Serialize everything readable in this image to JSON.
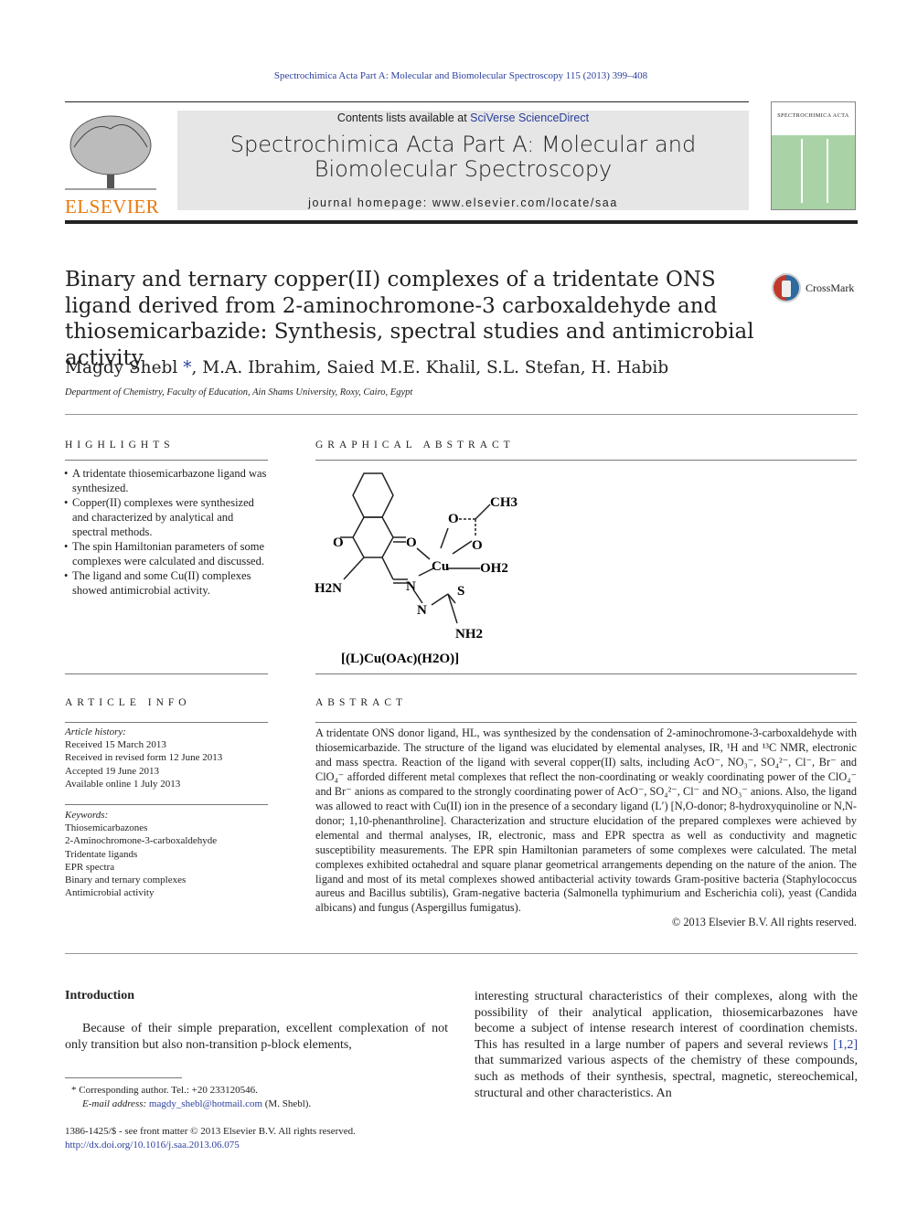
{
  "header": {
    "citation": "Spectrochimica Acta Part A: Molecular and Biomolecular Spectroscopy 115 (2013) 399–408",
    "contents_prefix": "Contents lists available at ",
    "contents_link": "SciVerse ScienceDirect",
    "journal_title_line1": "Spectrochimica Acta Part A: Molecular and",
    "journal_title_line2": "Biomolecular Spectroscopy",
    "homepage": "journal homepage: www.elsevier.com/locate/saa",
    "publisher_logo": "ELSEVIER",
    "cover_text": "SPECTROCHIMICA ACTA",
    "crossmark": "CrossMark"
  },
  "article": {
    "title": "Binary and ternary copper(II) complexes of a tridentate ONS ligand derived from 2-aminochromone-3 carboxaldehyde and thiosemicarbazide: Synthesis, spectral studies and antimicrobial activity",
    "authors_first": "Magdy Shebl",
    "author_mark": "*",
    "authors_rest": ", M.A. Ibrahim, Saied M.E. Khalil, S.L. Stefan, H. Habib",
    "affiliation": "Department of Chemistry, Faculty of Education, Ain Shams University, Roxy, Cairo, Egypt"
  },
  "highlights": {
    "heading": "HIGHLIGHTS",
    "items": [
      "A tridentate thiosemicarbazone ligand was synthesized.",
      "Copper(II) complexes were synthesized and characterized by analytical and spectral methods.",
      "The spin Hamiltonian parameters of some complexes were calculated and discussed.",
      "The ligand and some Cu(II) complexes showed antimicrobial activity."
    ]
  },
  "graphical_abstract": {
    "heading": "GRAPHICAL ABSTRACT",
    "labels": {
      "o_ring": "O",
      "o_carbonyl": "O",
      "h2n": "H2N",
      "n_imine": "N",
      "n_hydrazine": "N",
      "s": "S",
      "nh2": "NH2",
      "cu": "Cu",
      "oh2": "OH2",
      "o_acetate1": "O",
      "o_acetate2": "O",
      "ch3": "CH3"
    },
    "caption": "[(L)Cu(OAc)(H2O)]"
  },
  "article_info": {
    "heading": "ARTICLE INFO",
    "history_label": "Article history:",
    "history": [
      "Received 15 March 2013",
      "Received in revised form 12 June 2013",
      "Accepted 19 June 2013",
      "Available online 1 July 2013"
    ],
    "keywords_label": "Keywords:",
    "keywords": [
      "Thiosemicarbazones",
      "2-Aminochromone-3-carboxaldehyde",
      "Tridentate ligands",
      "EPR spectra",
      "Binary and ternary complexes",
      "Antimicrobial activity"
    ]
  },
  "abstract": {
    "heading": "ABSTRACT",
    "text": "A tridentate ONS donor ligand, HL, was synthesized by the condensation of 2-aminochromone-3-carboxaldehyde with thiosemicarbazide. The structure of the ligand was elucidated by elemental analyses, IR, ¹H and ¹³C NMR, electronic and mass spectra. Reaction of the ligand with several copper(II) salts, including AcO⁻, NO₃⁻, SO₄²⁻, Cl⁻, Br⁻ and ClO₄⁻ afforded different metal complexes that reflect the non-coordinating or weakly coordinating power of the ClO₄⁻ and Br⁻ anions as compared to the strongly coordinating power of AcO⁻, SO₄²⁻, Cl⁻ and NO₃⁻ anions. Also, the ligand was allowed to react with Cu(II) ion in the presence of a secondary ligand (L′) [N,O-donor; 8-hydroxyquinoline or N,N-donor; 1,10-phenanthroline]. Characterization and structure elucidation of the prepared complexes were achieved by elemental and thermal analyses, IR, electronic, mass and EPR spectra as well as conductivity and magnetic susceptibility measurements. The EPR spin Hamiltonian parameters of some complexes were calculated. The metal complexes exhibited octahedral and square planar geometrical arrangements depending on the nature of the anion. The ligand and most of its metal complexes showed antibacterial activity towards Gram-positive bacteria (Staphylococcus aureus and Bacillus subtilis), Gram-negative bacteria (Salmonella typhimurium and Escherichia coli), yeast (Candida albicans) and fungus (Aspergillus fumigatus).",
    "copyright": "© 2013 Elsevier B.V. All rights reserved."
  },
  "introduction": {
    "heading": "Introduction",
    "left_text": "Because of their simple preparation, excellent complexation of not only transition but also non-transition p-block elements,",
    "right_text_a": "interesting structural characteristics of their complexes, along with the possibility of their analytical application, thiosemicarbazones have become a subject of intense research interest of coordination chemists. This has resulted in a large number of papers and several reviews ",
    "right_ref": "[1,2]",
    "right_text_b": " that summarized various aspects of the chemistry of these compounds, such as methods of their synthesis, spectral, magnetic, stereochemical, structural and other characteristics. An"
  },
  "footnote": {
    "mark": "*",
    "corresponding": "Corresponding author. Tel.: +20 233120546.",
    "email_label": "E-mail address: ",
    "email": "magdy_shebl@hotmail.com",
    "email_suffix": " (M. Shebl)."
  },
  "footer": {
    "issn": "1386-1425/$ - see front matter © 2013 Elsevier B.V. All rights reserved.",
    "doi": "http://dx.doi.org/10.1016/j.saa.2013.06.075"
  }
}
